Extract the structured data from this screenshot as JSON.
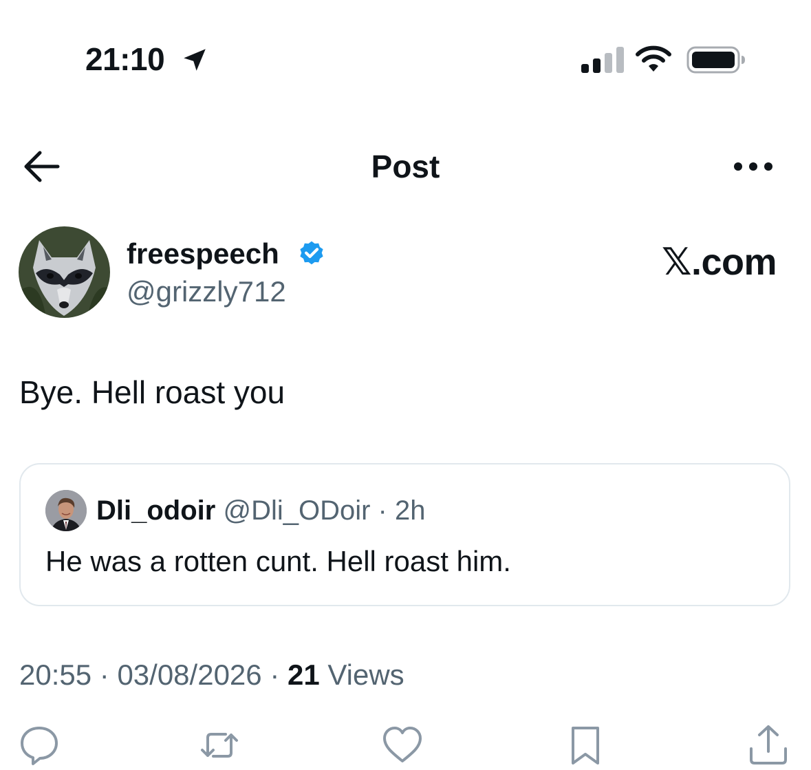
{
  "status_bar": {
    "time": "21:10",
    "icons": [
      "location-arrow-icon",
      "cellular-signal-icon",
      "wifi-icon",
      "battery-icon"
    ]
  },
  "header": {
    "title": "Post",
    "back_icon": "arrow-left-icon",
    "more_icon": "ellipsis-icon"
  },
  "post": {
    "author": {
      "display_name": "freespeech",
      "handle": "@grizzly712",
      "verified": true
    },
    "site_label": "𝕏.com",
    "text": "Bye. Hell roast you",
    "quoted": {
      "display_name": "Dli_odoir",
      "handle": "@Dli_ODoir",
      "separator": " · ",
      "age": "2h",
      "text": "He was a rotten cunt. Hell roast him."
    },
    "time": "20:55",
    "date": "03/08/2026",
    "separator": " · ",
    "views_count": "21",
    "views_label": " Views"
  },
  "actions": [
    "reply-icon",
    "repost-icon",
    "like-icon",
    "bookmark-icon",
    "share-icon"
  ],
  "colors": {
    "text": "#0f1419",
    "secondary": "#536471",
    "verified": "#1d9bf0",
    "border": "#e1e8ed",
    "icon": "#8b98a5"
  }
}
